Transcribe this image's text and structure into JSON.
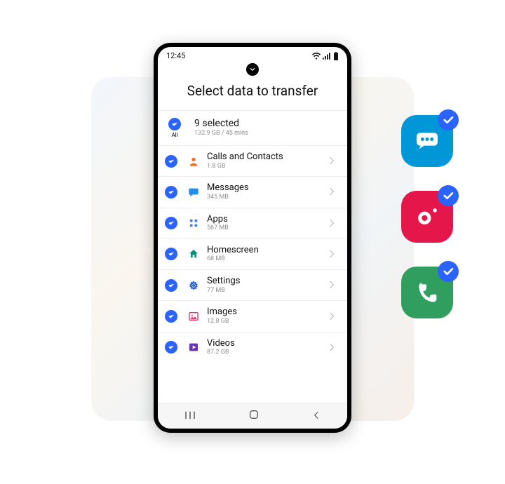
{
  "status": {
    "time": "12:45"
  },
  "title": "Select data to transfer",
  "summary": {
    "all_label": "All",
    "selected_label": "9 selected",
    "subtitle": "132.9 GB / 45 mins"
  },
  "items": [
    {
      "icon": "contact",
      "label": "Calls and Contacts",
      "size": "1.8 GB"
    },
    {
      "icon": "message",
      "label": "Messages",
      "size": "345 MB"
    },
    {
      "icon": "apps",
      "label": "Apps",
      "size": "567 MB"
    },
    {
      "icon": "home",
      "label": "Homescreen",
      "size": "68 MB"
    },
    {
      "icon": "settings",
      "label": "Settings",
      "size": "77 MB"
    },
    {
      "icon": "images",
      "label": "Images",
      "size": "12.8 GB"
    },
    {
      "icon": "videos",
      "label": "Videos",
      "size": "87.2 GB"
    }
  ],
  "colors": {
    "accent": "#2b63ff"
  },
  "float_icons": [
    {
      "name": "messages-app",
      "color": "#0097d8"
    },
    {
      "name": "camera-app",
      "color": "#e4164a"
    },
    {
      "name": "phone-app",
      "color": "#2f9e5f"
    }
  ]
}
